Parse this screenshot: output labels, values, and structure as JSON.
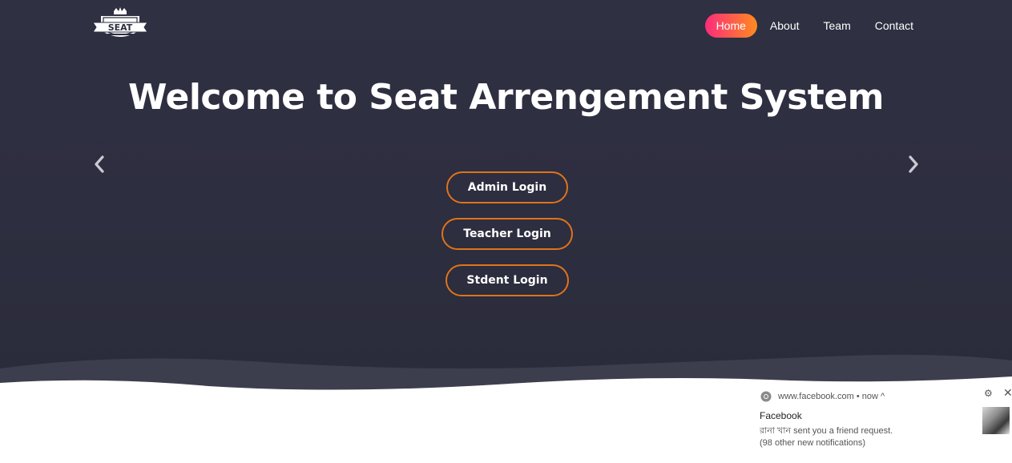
{
  "logo": {
    "text": "SEAT"
  },
  "nav": {
    "items": [
      {
        "label": "Home",
        "active": true
      },
      {
        "label": "About",
        "active": false
      },
      {
        "label": "Team",
        "active": false
      },
      {
        "label": "Contact",
        "active": false
      }
    ]
  },
  "hero": {
    "title": "Welcome to Seat Arrengement System",
    "buttons": {
      "admin": "Admin Login",
      "teacher": "Teacher Login",
      "student": "Stdent Login"
    }
  },
  "notification": {
    "source": "www.facebook.com",
    "time": "now",
    "app": "Facebook",
    "message": "রানা খান sent you a friend request.",
    "more": "(98 other new notifications)"
  },
  "colors": {
    "hero_bg": "#2d2e3f",
    "accent_start": "#fc2c7c",
    "accent_end": "#ff8b1f",
    "button_border": "#e0731b"
  }
}
